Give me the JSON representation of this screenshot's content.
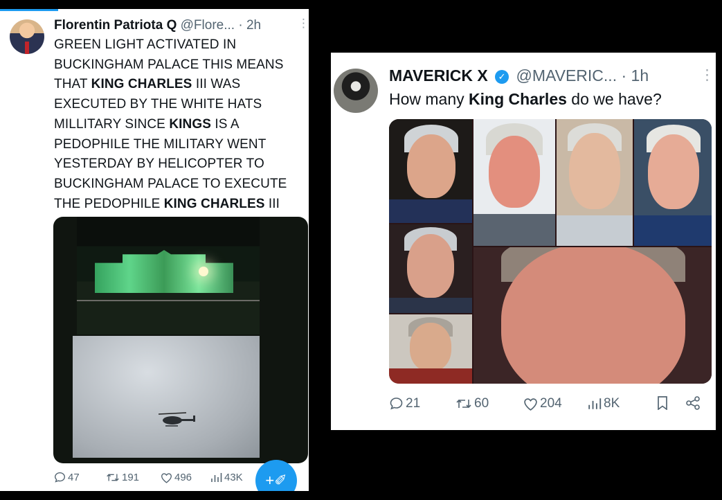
{
  "left_post": {
    "display_name": "Florentin Patriota Q",
    "handle": "@Flore...",
    "time": "· 2h",
    "more": "⋮",
    "text_segments": [
      {
        "t": "GREEN LIGHT ACTIVATED IN BUCKINGHAM PALACE THIS MEANS THAT ",
        "bold": false
      },
      {
        "t": "KING CHARLES",
        "bold": true
      },
      {
        "t": " III WAS EXECUTED BY THE WHITE HATS MILLITARY SINCE ",
        "bold": false
      },
      {
        "t": "KINGS",
        "bold": true
      },
      {
        "t": " IS A PEDOPHILE THE MILITARY WENT YESTERDAY BY HELICOPTER TO BUCKINGHAM PALACE TO EXECUTE THE PEDOPHILE ",
        "bold": false
      },
      {
        "t": "KING CHARLES",
        "bold": true
      },
      {
        "t": " III",
        "bold": false
      }
    ],
    "actions": {
      "replies": "47",
      "reposts": "191",
      "likes": "496",
      "views": "43K"
    },
    "fab_icon": "compose-icon",
    "fab_glyph": "+✐"
  },
  "right_post": {
    "display_name": "MAVERICK X",
    "handle": "@MAVERIC...",
    "time": "· 1h",
    "more": "⋮",
    "text_segments": [
      {
        "t": "How many ",
        "bold": false
      },
      {
        "t": "King Charles",
        "bold": true
      },
      {
        "t": " do we have?",
        "bold": false
      }
    ],
    "actions": {
      "replies": "21",
      "reposts": "60",
      "likes": "204",
      "views": "8K"
    }
  },
  "colors": {
    "accent": "#1d9bf0",
    "muted": "#536471"
  }
}
